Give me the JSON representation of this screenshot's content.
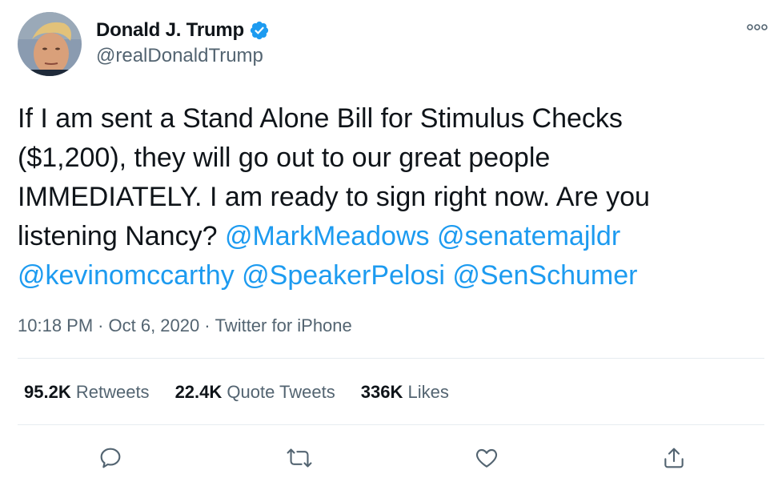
{
  "author": {
    "name": "Donald J. Trump",
    "handle": "@realDonaldTrump",
    "verified_icon": "verified-badge-icon"
  },
  "more_icon": "more-options-icon",
  "text": {
    "line1": "If I am sent a Stand Alone Bill for Stimulus Checks",
    "line2": "($1,200), they will go out to our great people",
    "line3": "IMMEDIATELY. I am ready to sign right now. Are you",
    "line4_prefix": "listening Nancy?",
    "mentions": [
      "@MarkMeadows",
      "@senatemajldr",
      "@kevinomccarthy",
      "@SpeakerPelosi",
      "@SenSchumer"
    ]
  },
  "meta": {
    "time": "10:18 PM",
    "date": "Oct 6, 2020",
    "source": "Twitter for iPhone",
    "separator": "·"
  },
  "stats": [
    {
      "count": "95.2K",
      "label": "Retweets"
    },
    {
      "count": "22.4K",
      "label": "Quote Tweets"
    },
    {
      "count": "336K",
      "label": "Likes"
    }
  ],
  "actions": [
    "reply-icon",
    "retweet-icon",
    "like-icon",
    "share-icon"
  ],
  "colors": {
    "accent": "#1d9bf0",
    "text": "#0f1419",
    "muted": "#536471",
    "divider": "#e6ecf0"
  }
}
